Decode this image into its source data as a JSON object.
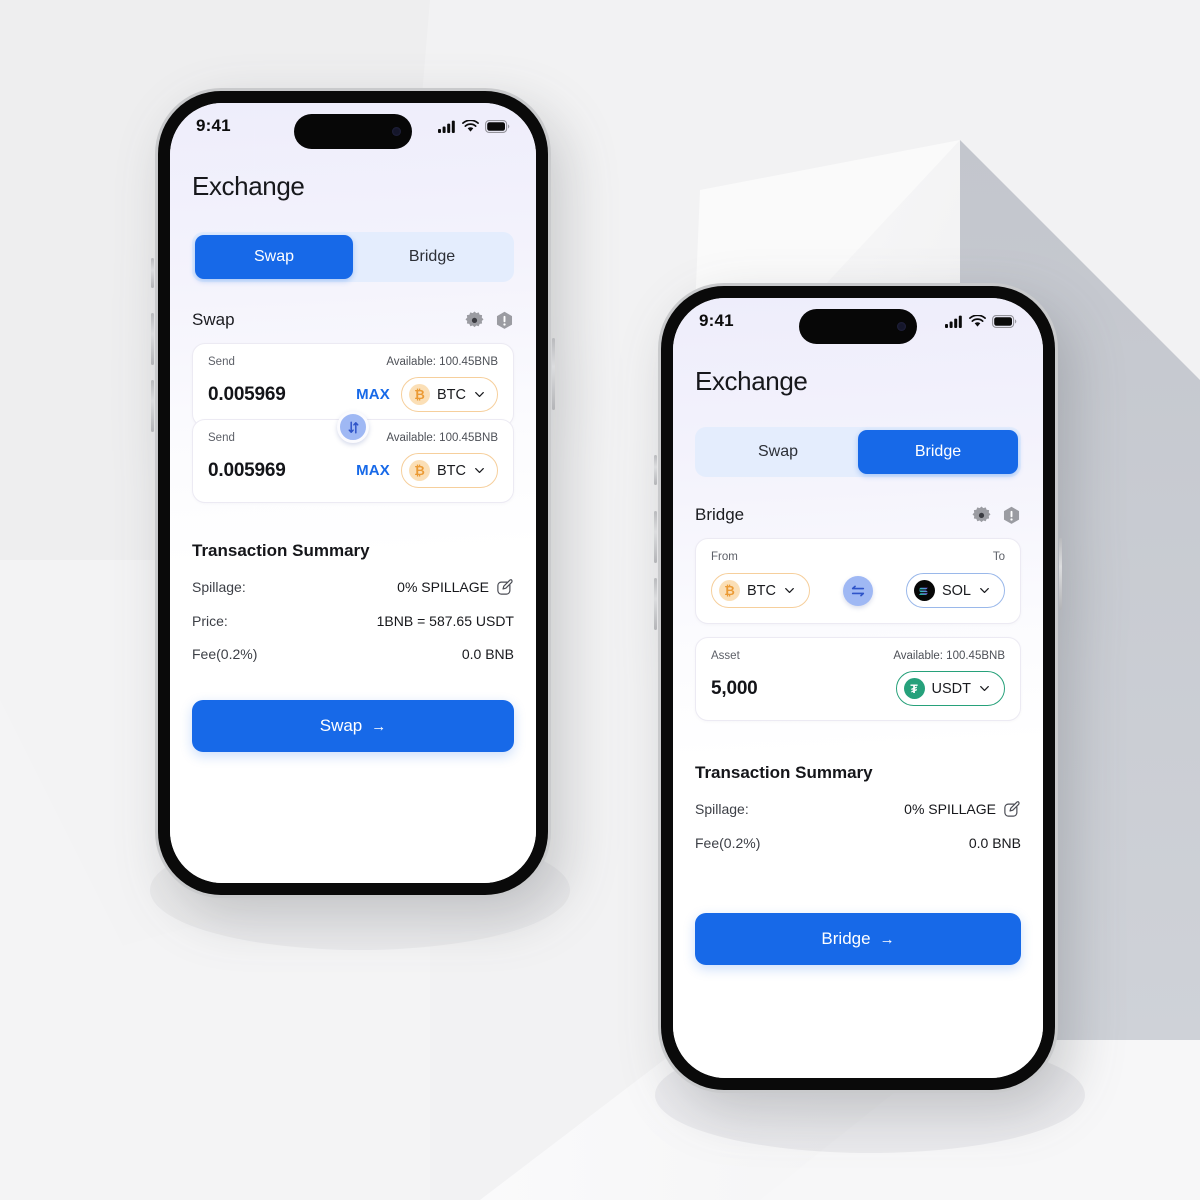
{
  "background": {
    "base_color": "#ececed",
    "shape_colors": [
      "#f7f7f8",
      "#c2c5cc",
      "#d7d9de",
      "#fbfbfb",
      "#e3e4e6"
    ]
  },
  "theme": {
    "accent": "#1769e8",
    "segment_track": "#e4edfd",
    "btc_border": "#f6cf9c",
    "sol_border": "#9ab8ea",
    "usdt_border": "#27a17b",
    "max_color": "#1769e8"
  },
  "phones": [
    {
      "id": "phone-swap",
      "status_bar": {
        "time": "9:41",
        "cellular_icon": "cellular-bars-icon",
        "wifi_icon": "wifi-icon",
        "battery_icon": "battery-icon"
      },
      "app_title": "Exchange",
      "tabs": [
        {
          "label": "Swap",
          "active": true
        },
        {
          "label": "Bridge",
          "active": false
        }
      ],
      "section": {
        "title": "Swap",
        "icons": [
          "gear-icon",
          "alert-hexagon-icon"
        ]
      },
      "fields": [
        {
          "label": "Send",
          "available": "Available: 100.45BNB",
          "amount": "0.005969",
          "max_label": "MAX",
          "token": {
            "symbol": "BTC",
            "icon": "btc-icon",
            "chevron": "chevron-down-icon"
          }
        },
        {
          "label": "Send",
          "available": "Available: 100.45BNB",
          "amount": "0.005969",
          "max_label": "MAX",
          "token": {
            "symbol": "BTC",
            "icon": "btc-icon",
            "chevron": "chevron-down-icon"
          }
        }
      ],
      "swap_toggle_icon": "swap-vertical-arrows-icon",
      "summary": {
        "title": "Transaction Summary",
        "rows": [
          {
            "key": "Spillage:",
            "value": "0% SPILLAGE",
            "icon": "edit-pencil-icon"
          },
          {
            "key": "Price:",
            "value": "1BNB = 587.65 USDT",
            "icon": ""
          },
          {
            "key": "Fee(0.2%)",
            "value": "0.0 BNB",
            "icon": ""
          }
        ]
      },
      "cta": {
        "label": "Swap",
        "arrow": "→"
      }
    },
    {
      "id": "phone-bridge",
      "status_bar": {
        "time": "9:41",
        "cellular_icon": "cellular-bars-icon",
        "wifi_icon": "wifi-icon",
        "battery_icon": "battery-icon"
      },
      "app_title": "Exchange",
      "tabs": [
        {
          "label": "Swap",
          "active": false
        },
        {
          "label": "Bridge",
          "active": true
        }
      ],
      "section": {
        "title": "Bridge",
        "icons": [
          "gear-icon",
          "alert-hexagon-icon"
        ]
      },
      "chain_row": {
        "from_label": "From",
        "to_label": "To",
        "from_token": {
          "symbol": "BTC",
          "icon": "btc-icon",
          "chevron": "chevron-down-icon"
        },
        "to_token": {
          "symbol": "SOL",
          "icon": "sol-icon",
          "chevron": "chevron-down-icon"
        },
        "switch_icon": "swap-horizontal-arrows-icon"
      },
      "asset_field": {
        "label": "Asset",
        "available": "Available: 100.45BNB",
        "amount": "5,000",
        "token": {
          "symbol": "USDT",
          "icon": "usdt-icon",
          "chevron": "chevron-down-icon"
        }
      },
      "summary": {
        "title": "Transaction Summary",
        "rows": [
          {
            "key": "Spillage:",
            "value": "0% SPILLAGE",
            "icon": "edit-pencil-icon"
          },
          {
            "key": "Fee(0.2%)",
            "value": "0.0 BNB",
            "icon": ""
          }
        ]
      },
      "cta": {
        "label": "Bridge",
        "arrow": "→"
      }
    }
  ]
}
